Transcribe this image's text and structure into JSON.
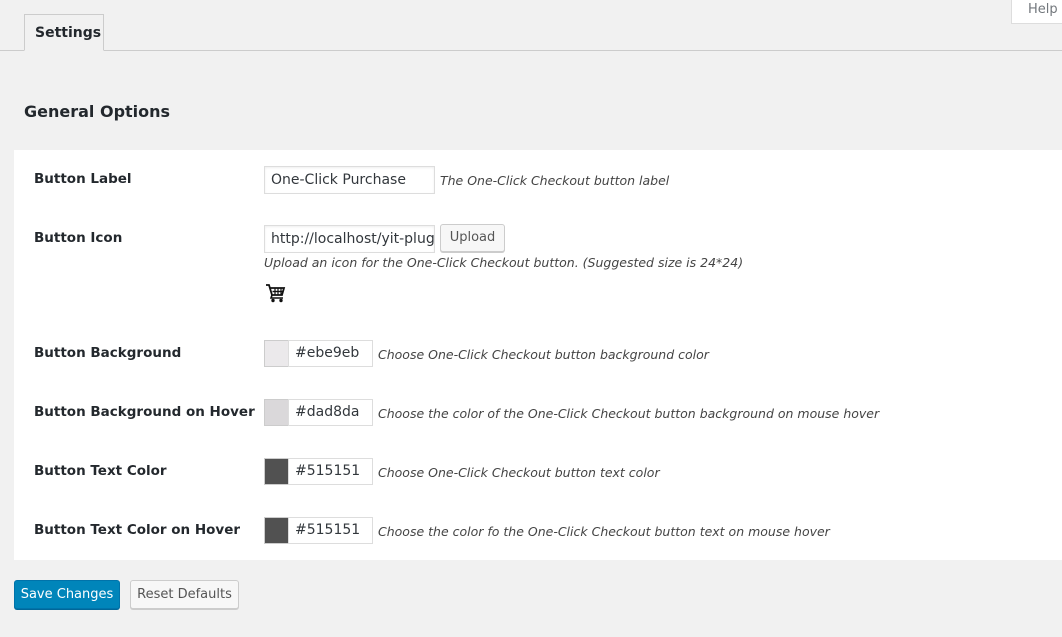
{
  "help": {
    "label": "Help"
  },
  "tabs": [
    {
      "label": "Settings",
      "active": true
    }
  ],
  "section": {
    "title": "General Options"
  },
  "fields": {
    "button_label": {
      "label": "Button Label",
      "value": "One-Click Purchase",
      "description": "The One-Click Checkout button label"
    },
    "button_icon": {
      "label": "Button Icon",
      "value": "http://localhost/yit-plugi",
      "upload_label": "Upload",
      "description": "Upload an icon for the One-Click Checkout button. (Suggested size is 24*24)",
      "preview_icon": "shopping-cart-icon"
    },
    "button_background": {
      "label": "Button Background",
      "value": "#ebe9eb",
      "swatch_color": "#ebe9eb",
      "description": "Choose One-Click Checkout button background color"
    },
    "button_background_hover": {
      "label": "Button Background on Hover",
      "value": "#dad8da",
      "swatch_color": "#dad8da",
      "description": "Choose the color of the One-Click Checkout button background on mouse hover"
    },
    "button_text_color": {
      "label": "Button Text Color",
      "value": "#515151",
      "swatch_color": "#515151",
      "description": "Choose One-Click Checkout button text color"
    },
    "button_text_color_hover": {
      "label": "Button Text Color on Hover",
      "value": "#515151",
      "swatch_color": "#515151",
      "description": "Choose the color fo the One-Click Checkout button text on mouse hover"
    }
  },
  "actions": {
    "save_label": "Save Changes",
    "reset_label": "Reset Defaults"
  },
  "colors": {
    "primary": "#0085ba",
    "background": "#f1f1f1",
    "panel": "#ffffff"
  }
}
